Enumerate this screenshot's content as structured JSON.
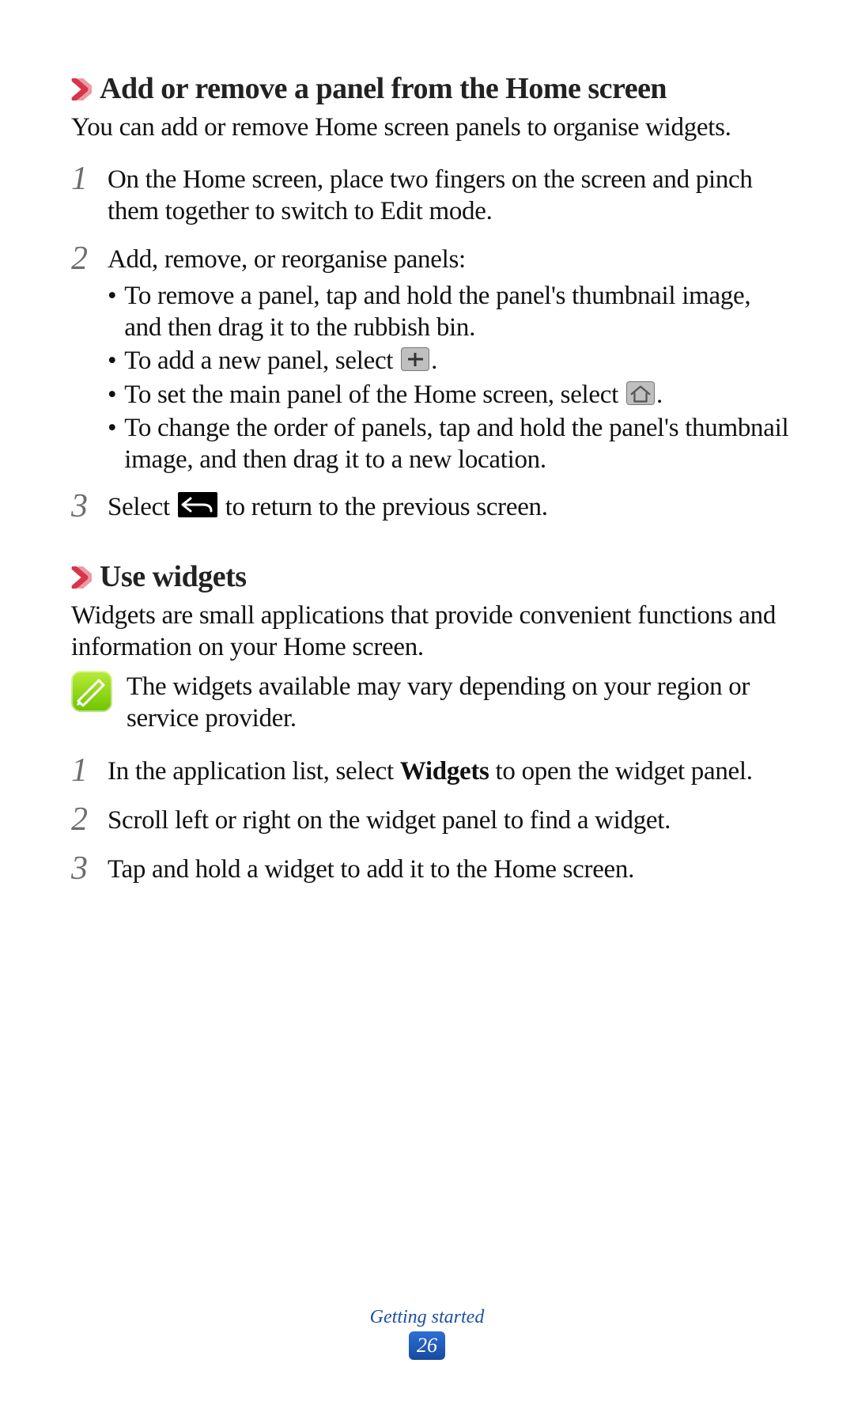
{
  "section1": {
    "title": "Add or remove a panel from the Home screen",
    "desc": "You can add or remove Home screen panels to organise widgets.",
    "steps": {
      "s1": "On the Home screen, place two fingers on the screen and pinch them together to switch to Edit mode.",
      "s2_intro": "Add, remove, or reorganise panels:",
      "b1": "To remove a panel, tap and hold the panel's thumbnail image, and then drag it to the rubbish bin.",
      "b2_pre": "To add a new panel, select ",
      "b2_post": ".",
      "b3_pre": "To set the main panel of the Home screen, select ",
      "b3_post": ".",
      "b4": "To change the order of panels, tap and hold the panel's thumbnail image, and then drag it to a new location.",
      "s3_pre": "Select ",
      "s3_post": " to return to the previous screen."
    }
  },
  "section2": {
    "title": "Use widgets",
    "desc": "Widgets are small applications that provide convenient functions and information on your Home screen.",
    "note": "The widgets available may vary depending on your region or service provider.",
    "steps": {
      "s1_pre": "In the application list, select ",
      "s1_bold": "Widgets",
      "s1_post": " to open the widget panel.",
      "s2": "Scroll left or right on the widget panel to find a widget.",
      "s3": "Tap and hold a widget to add it to the Home screen."
    }
  },
  "footer": {
    "label": "Getting started",
    "page": "26"
  }
}
